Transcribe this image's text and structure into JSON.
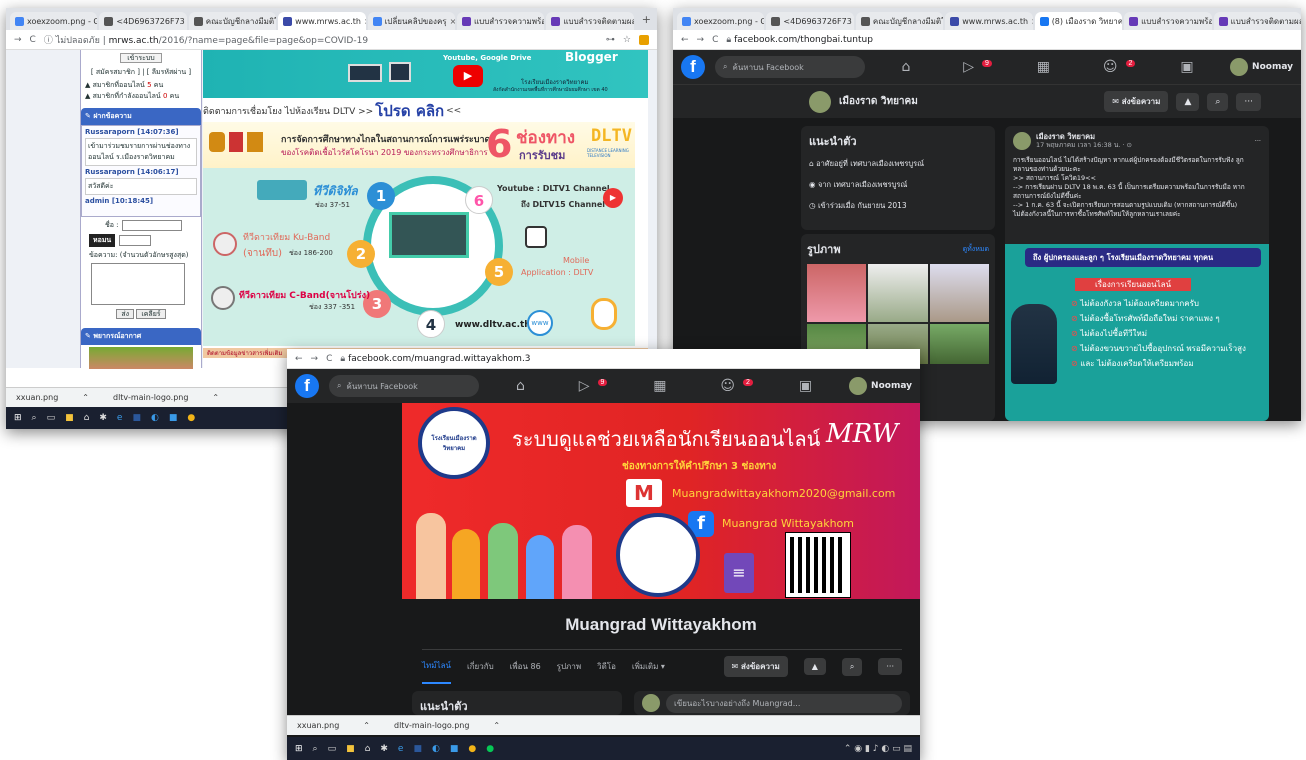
{
  "win1": {
    "tabs": [
      "xoexzoom.png - G",
      "<4D6963726F73",
      "คณะบัญชีกลางมีมติให้",
      "www.mrws.ac.th",
      "เปลี่ยนคลิปของครุ",
      "แบบสำรวจความพร้อม",
      "แบบสำรวจติดตามผล"
    ],
    "address_insecure": "ไม่ปลอดภัย",
    "address_domain": "mrws.ac.th",
    "address_path": "/2016/?name=page&file=page&op=COVID-19",
    "sidebar": {
      "login_btn": "เข้าระบบ",
      "register_line": "[ สมัครสมาชิก ] | [ ลืมรหัสผ่าน ]",
      "members_label": "สมาชิกที่ออนไลน์",
      "members_count": "5",
      "members_unit": "คน",
      "guests_label": "สมาชิกที่กำลังออนไลน์",
      "guests_count": "0",
      "guests_unit": "คน",
      "chat_header": "ฝากข้อความ",
      "chat_entries": [
        {
          "user": "Russaraporn [14:07:36]",
          "text": "เข้ามาร่วมชมรายการผ่านช่องทางออนไลน์ ร.เมืองราดวิทยาคม"
        },
        {
          "user": "Russaraporn [14:06:17]",
          "text": "สวัสดีค่ะ"
        },
        {
          "user": "admin [10:18:45]",
          "text": ""
        }
      ],
      "name_label": "ชื่อ :",
      "captcha": "หอมน",
      "message_label": "ข้อความ: (จำนวนตัวอักษรสูงสุด)",
      "send_btn": "ส่ง",
      "clear_btn": "เคลียร์",
      "news_header": "พยากรณ์อากาศ"
    },
    "banner_blogger": "Blogger",
    "banner_youtube": "Youtube, Google Drive",
    "banner_small1": "โรงเรียนเมืองราดวิทยาคม",
    "banner_small2": "สังกัดสำนักงานเขตพื้นที่การศึกษามัธยมศึกษา เขต 40",
    "link_line_prefix": "ติดตามการเชื่อมโยง ไปห้องเรียน DLTV >>",
    "link_line_main": "โปรด คลิก",
    "link_line_suffix": "<<",
    "poster": {
      "heading": "การจัดการศึกษาทางไกลในสถานการณ์การแพร่ระบาด",
      "subheading": "ของโรคติดเชื้อไวรัสโคโรนา 2019 ของกระทรวงศึกษาธิการ",
      "big_count": "6",
      "channels_word": "ช่องทาง",
      "receive_word": "การรับชม",
      "dltv": "DLTV",
      "dltv_sub": "DISTANCE LEARNING TELEVISION",
      "ch1_title": "ทีวีดิจิทัล",
      "ch1_sub": "ช่อง 37-51",
      "ch2_title": "ทีวีดาวเทียม Ku-Band",
      "ch2_title2": "(จานทึบ)",
      "ch2_sub": "ช่อง 186-200",
      "ch3_title": "ทีวีดาวเทียม C-Band(จานโปร่ง)",
      "ch3_sub": "ช่อง 337 -351",
      "ch4_site": "www.dltv.ac.th",
      "ch5_title": "Mobile",
      "ch5_sub": "Application : DLTV",
      "ch6_title": "Youtube : DLTV1 Channel",
      "ch6_sub": "ถึง DLTV15 Channel",
      "www": "www",
      "num1": "1",
      "num2": "2",
      "num3": "3",
      "num4": "4",
      "num5": "5",
      "num6": "6",
      "footer": "ติดตามข้อมูลข่าวสารเพิ่มเติม"
    },
    "downloads": [
      "xxuan.png",
      "dltv-main-logo.png"
    ]
  },
  "win2": {
    "tabs": [
      "xoexzoom.png - G",
      "<4D6963726F73",
      "คณะบัญชีกลางมีมติให้",
      "www.mrws.ac.th",
      "(8) เมืองราด วิทยาคม",
      "แบบสำรวจความพร้อม",
      "แบบสำรวจติดตามผล"
    ],
    "address": "facebook.com/thongbai.tuntup",
    "search_placeholder": "ค้นหาบน Facebook",
    "badge1": "9",
    "badge2": "2",
    "user": "Noomay",
    "page_name": "เมืองราด วิทยาคม",
    "message_btn": "ส่งข้อความ",
    "intro_title": "แนะนำตัว",
    "intro_items": [
      "อาศัยอยู่ที่ เทศบาลเมืองเพชรบูรณ์",
      "จาก เทศบาลเมืองเพชรบูรณ์",
      "เข้าร่วมเมื่อ กันยายน 2013"
    ],
    "photos_title": "รูปภาพ",
    "photos_link": "ดูทั้งหมด",
    "post_author": "เมืองราด วิทยาคม",
    "post_time": "17 พฤษภาคม เวลา 16:38 น. · ⊙",
    "post_lines": [
      "การเรียนออนไลน์ ไม่ได้สร้างปัญหา หากแต่ผู้ปกครองต้องมีชีวิตรอดในการรับฟัง ลูก หลานของท่านด้วยนะคะ",
      ">> สถานการณ์ โควิด19<<",
      "--> การเรียนผ่าน DLTV 18 พ.ค. 63 นี้ เป็นการเตรียมความพร้อมในการรับมือ หากสถานการณ์ยังไม่ดีขึ้นค่ะ",
      "--> 1 ก.ค. 63 นี้ จะเปิดการเรียนการสอนตามรูปแบบเดิม (หากสถานการณ์ดีขึ้น)",
      "ไม่ต้องกังวลนี้ในการหาซื้อโทรศัพท์ใหม่ให้ลูกหลานเราเลยค่ะ"
    ],
    "post_banner": "ถึง ผู้ปกครองและลูก ๆ โรงเรียนเมืองราดวิทยาคม ทุกคน",
    "post_subbanner": "เรื่องการเรียนออนไลน์",
    "post_points": [
      "ไม่ต้องกังวล ไม่ต้องเครียดมากครับ",
      "ไม่ต้องซื้อโทรศัพท์มือถือใหม่ ราคาแพง ๆ",
      "ไม่ต้องไปซื้อทีวีใหม่",
      "ไม่ต้องขวนขวายไปซื้ออุปกรณ์ พรอมีความเร็วสูง",
      "และ ไม่ต้องเครียดให้เตรียมพร้อม"
    ]
  },
  "win3": {
    "address": "facebook.com/muangrad.wittayakhom.3",
    "search_placeholder": "ค้นหาบน Facebook",
    "badge1": "9",
    "badge2": "2",
    "user": "Noomay",
    "cover_title": "ระบบดูแลช่วยเหลือนักเรียนออนไลน์",
    "cover_mrw": "MRW",
    "cover_sub": "ช่องทางการให้คำปรึกษา 3 ช่องทาง",
    "cover_email": "Muangradwittayakhom2020@gmail.com",
    "cover_fb": "Muangrad Wittayakhom",
    "school_seal_text": "โรงเรียนเมืองราดวิทยาคม",
    "profile_name": "Muangrad Wittayakhom",
    "nav_tabs": [
      "ไทม์ไลน์",
      "เกี่ยวกับ",
      "เพื่อน 86",
      "รูปภาพ",
      "วิดีโอ",
      "เพิ่มเติม ▾"
    ],
    "message_btn": "ส่งข้อความ",
    "intro_title": "แนะนำตัว",
    "composer_placeholder": "เขียนอะไรบางอย่างถึง Muangrad...",
    "downloads": [
      "xxuan.png",
      "dltv-main-logo.png"
    ]
  },
  "colors": {
    "fb_blue": "#1877f2",
    "fb_dark": "#18191a",
    "accent_red": "#e41e3f"
  }
}
